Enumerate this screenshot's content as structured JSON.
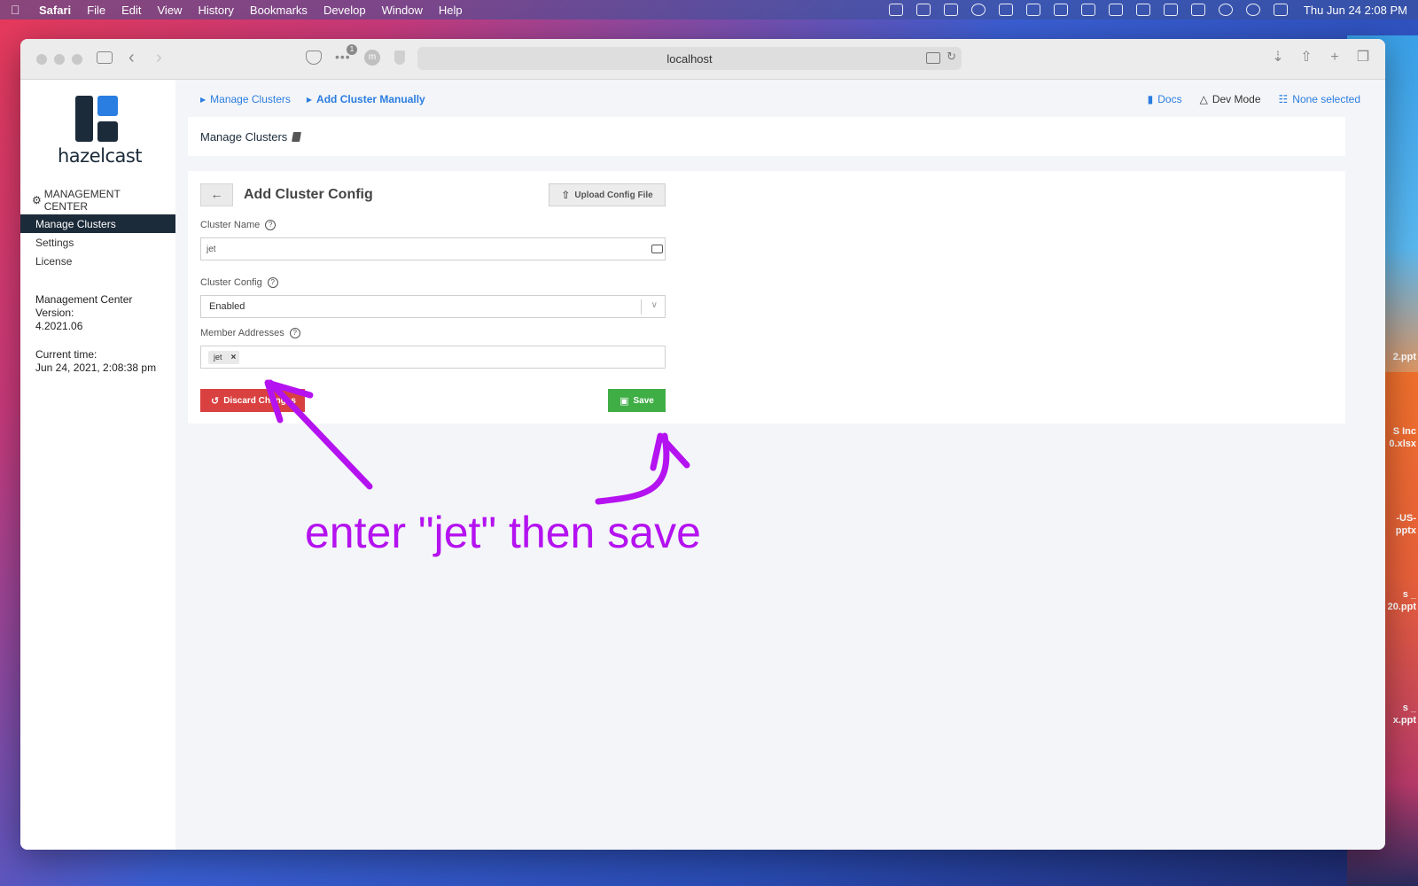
{
  "menubar": {
    "app_name": "Safari",
    "items": [
      "File",
      "Edit",
      "View",
      "History",
      "Bookmarks",
      "Develop",
      "Window",
      "Help"
    ],
    "clock": "Thu Jun 24  2:08 PM"
  },
  "browser": {
    "url": "localhost",
    "extension_badge": "1",
    "extension_m": "m"
  },
  "sidebar": {
    "logo_text": "hazelcast",
    "section_title": "MANAGEMENT CENTER",
    "items": [
      {
        "label": "Manage Clusters",
        "active": true
      },
      {
        "label": "Settings",
        "active": false
      },
      {
        "label": "License",
        "active": false
      }
    ],
    "version_label": "Management Center Version:",
    "version_value": "4.2021.06",
    "time_label": "Current time:",
    "time_value": "Jun 24, 2021, 2:08:38 pm"
  },
  "breadcrumb": {
    "items": [
      "Manage Clusters",
      "Add Cluster Manually"
    ]
  },
  "top_actions": {
    "docs": "Docs",
    "dev_mode": "Dev Mode",
    "none_selected": "None selected"
  },
  "page_title": "Manage Clusters",
  "form": {
    "title": "Add Cluster Config",
    "upload_label": "Upload Config File",
    "cluster_name_label": "Cluster Name",
    "cluster_name_value": "jet",
    "cluster_config_label": "Cluster Config",
    "cluster_config_value": "Enabled",
    "member_addresses_label": "Member Addresses",
    "member_tag": "jet",
    "discard_label": "Discard Changes",
    "save_label": "Save"
  },
  "annotation": {
    "text": "enter \"jet\" then save",
    "color": "#b412f0"
  },
  "desktop_files": [
    "2.ppt",
    "S Inc",
    "0.xlsx",
    "-US-",
    "pptx",
    "s _",
    "20.ppt",
    "s _",
    "x.ppt"
  ]
}
